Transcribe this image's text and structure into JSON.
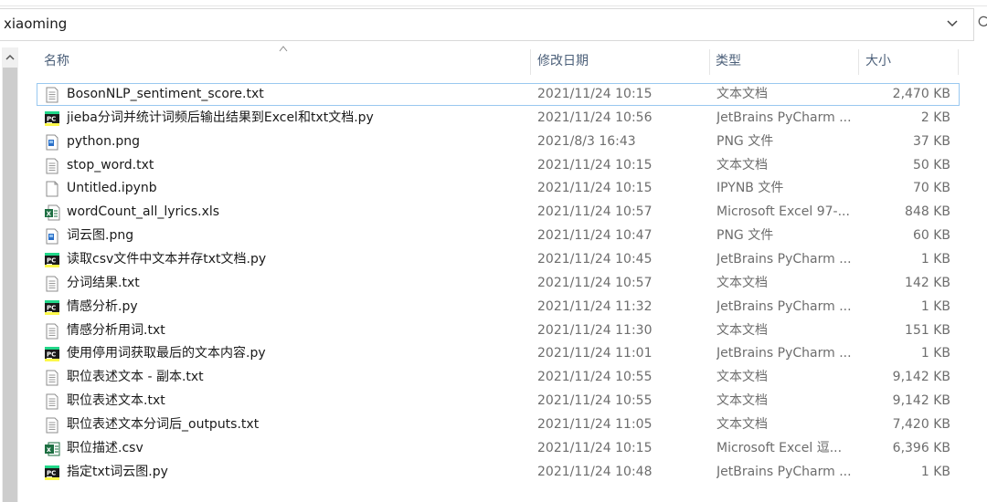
{
  "address": {
    "path": "xiaoming"
  },
  "columns": {
    "name": "名称",
    "date": "修改日期",
    "type": "类型",
    "size": "大小"
  },
  "files": [
    {
      "name": "BosonNLP_sentiment_score.txt",
      "date": "2021/11/24 10:15",
      "type": "文本文档",
      "size": "2,470 KB",
      "icon": "txt-file-icon"
    },
    {
      "name": "jieba分词并统计词频后输出结果到Excel和txt文档.py",
      "date": "2021/11/24 10:56",
      "type": "JetBrains PyCharm ...",
      "size": "2 KB",
      "icon": "pycharm-file-icon"
    },
    {
      "name": "python.png",
      "date": "2021/8/3 16:43",
      "type": "PNG 文件",
      "size": "37 KB",
      "icon": "png-file-icon"
    },
    {
      "name": "stop_word.txt",
      "date": "2021/11/24 10:15",
      "type": "文本文档",
      "size": "50 KB",
      "icon": "txt-file-icon"
    },
    {
      "name": "Untitled.ipynb",
      "date": "2021/11/24 10:15",
      "type": "IPYNB 文件",
      "size": "70 KB",
      "icon": "blank-file-icon"
    },
    {
      "name": "wordCount_all_lyrics.xls",
      "date": "2021/11/24 10:57",
      "type": "Microsoft Excel 97-...",
      "size": "848 KB",
      "icon": "excel-file-icon"
    },
    {
      "name": "词云图.png",
      "date": "2021/11/24 10:47",
      "type": "PNG 文件",
      "size": "60 KB",
      "icon": "png-file-icon"
    },
    {
      "name": "读取csv文件中文本并存txt文档.py",
      "date": "2021/11/24 10:45",
      "type": "JetBrains PyCharm ...",
      "size": "1 KB",
      "icon": "pycharm-file-icon"
    },
    {
      "name": "分词结果.txt",
      "date": "2021/11/24 10:57",
      "type": "文本文档",
      "size": "142 KB",
      "icon": "txt-file-icon"
    },
    {
      "name": "情感分析.py",
      "date": "2021/11/24 11:32",
      "type": "JetBrains PyCharm ...",
      "size": "1 KB",
      "icon": "pycharm-file-icon"
    },
    {
      "name": "情感分析用词.txt",
      "date": "2021/11/24 11:30",
      "type": "文本文档",
      "size": "151 KB",
      "icon": "txt-file-icon"
    },
    {
      "name": "使用停用词获取最后的文本内容.py",
      "date": "2021/11/24 11:01",
      "type": "JetBrains PyCharm ...",
      "size": "1 KB",
      "icon": "pycharm-file-icon"
    },
    {
      "name": "职位表述文本 - 副本.txt",
      "date": "2021/11/24 10:55",
      "type": "文本文档",
      "size": "9,142 KB",
      "icon": "txt-file-icon"
    },
    {
      "name": "职位表述文本.txt",
      "date": "2021/11/24 10:55",
      "type": "文本文档",
      "size": "9,142 KB",
      "icon": "txt-file-icon"
    },
    {
      "name": "职位表述文本分词后_outputs.txt",
      "date": "2021/11/24 11:05",
      "type": "文本文档",
      "size": "7,420 KB",
      "icon": "txt-file-icon"
    },
    {
      "name": "职位描述.csv",
      "date": "2021/11/24 10:15",
      "type": "Microsoft Excel 逗...",
      "size": "6,396 KB",
      "icon": "csv-file-icon"
    },
    {
      "name": "指定txt词云图.py",
      "date": "2021/11/24 10:48",
      "type": "JetBrains PyCharm ...",
      "size": "1 KB",
      "icon": "pycharm-file-icon"
    }
  ],
  "colors": {
    "header_text": "#4c607a",
    "detail_text": "#6d6d6d",
    "focus_outline": "#99c8f0"
  }
}
